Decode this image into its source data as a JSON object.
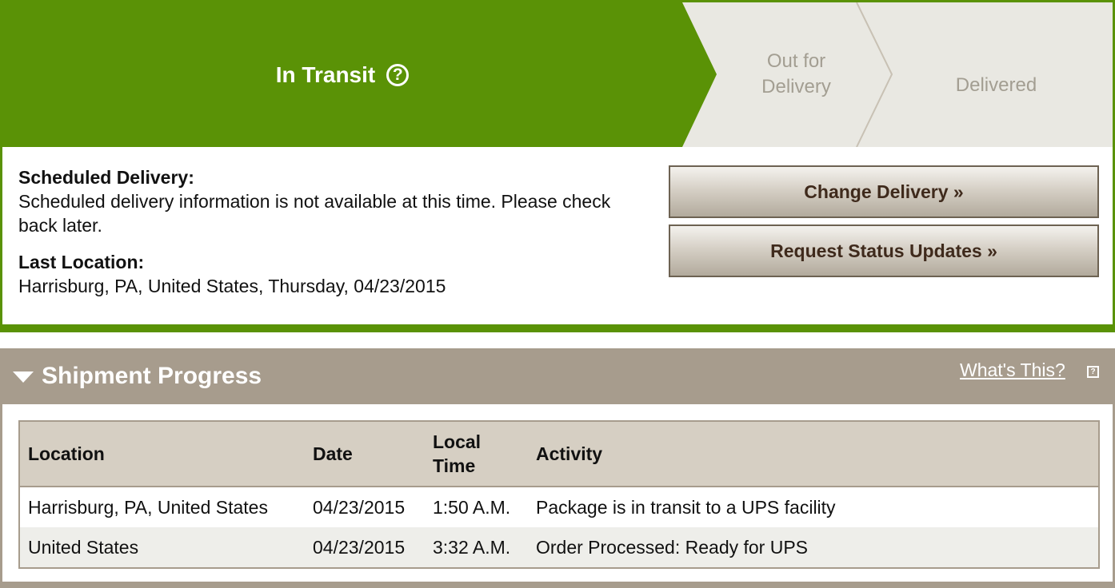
{
  "status_tracker": {
    "current_step": "In Transit",
    "help_glyph": "?",
    "steps": [
      "Out for",
      "Delivery",
      "Delivered"
    ],
    "colors": {
      "active": "#5a9206",
      "inactive": "#e9e8e2",
      "inactive_text": "#a39e92"
    }
  },
  "delivery_info": {
    "scheduled_label": "Scheduled Delivery:",
    "scheduled_text": "Scheduled delivery information is not available at this time. Please check back later.",
    "last_location_label": "Last Location:",
    "last_location_text": "Harrisburg, PA, United States, Thursday, 04/23/2015"
  },
  "actions": {
    "change_delivery": "Change Delivery »",
    "request_updates": "Request Status Updates »"
  },
  "shipment_progress": {
    "title": "Shipment Progress",
    "whats_this": "What's This?",
    "columns": [
      "Location",
      "Date",
      "Local Time",
      "Activity"
    ],
    "rows": [
      [
        "Harrisburg, PA, United States",
        "04/23/2015",
        "1:50 A.M.",
        "Package is in transit to a UPS facility"
      ],
      [
        "United States",
        "04/23/2015",
        "3:32 A.M.",
        "Order Processed: Ready for UPS"
      ]
    ]
  }
}
